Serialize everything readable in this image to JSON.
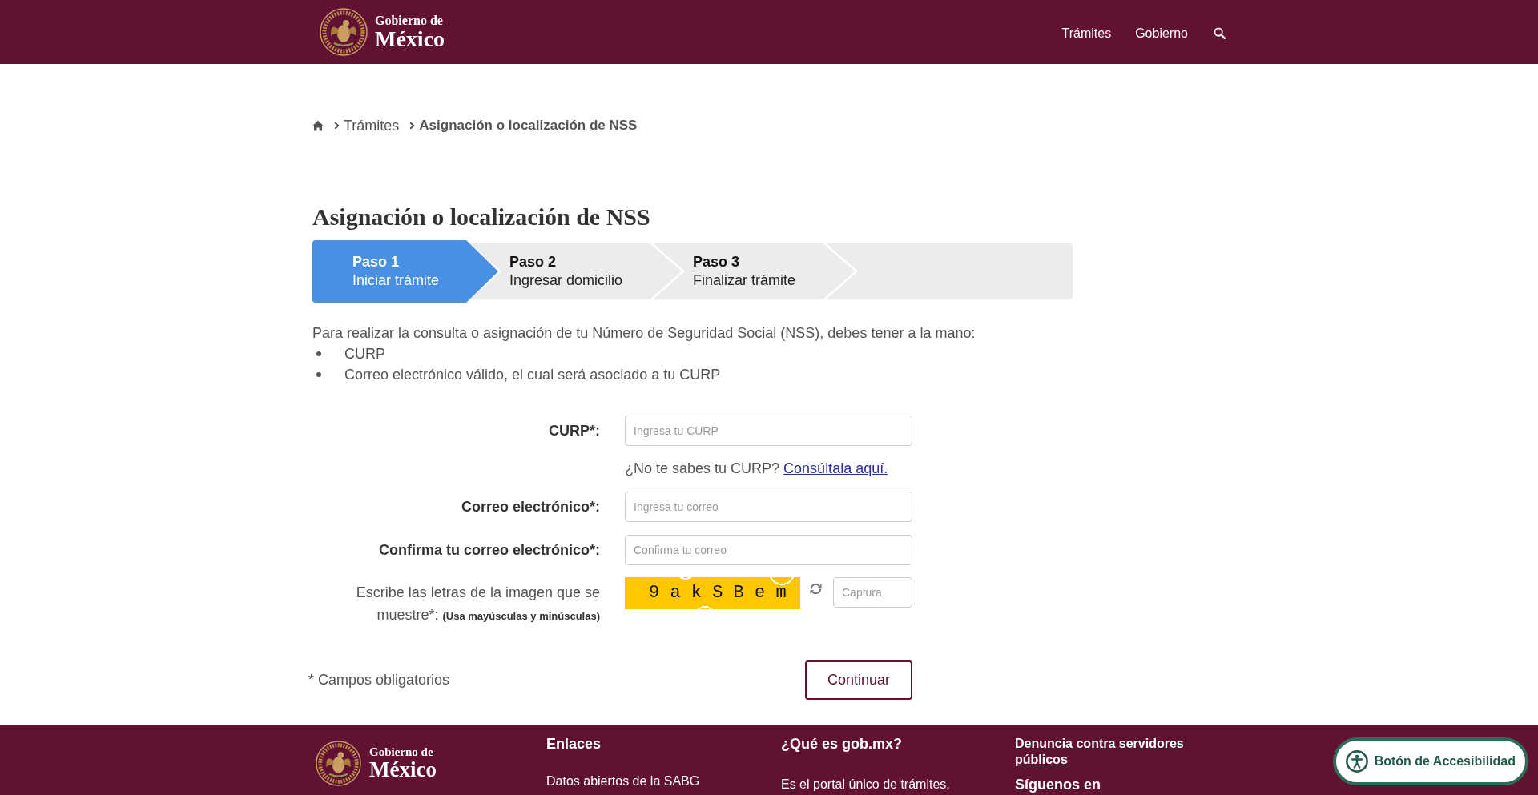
{
  "header": {
    "logo": {
      "line1": "Gobierno de",
      "line2": "México"
    },
    "nav": [
      "Trámites",
      "Gobierno"
    ]
  },
  "breadcrumb": [
    {
      "label": "Trámites",
      "current": false
    },
    {
      "label": "Asignación o localización de NSS",
      "current": true
    }
  ],
  "title": "Asignación o localización de NSS",
  "steps": [
    {
      "label": "Paso 1",
      "description": "Iniciar trámite",
      "selected": true
    },
    {
      "label": "Paso 2",
      "description": "Ingresar domicilio",
      "selected": false
    },
    {
      "label": "Paso 3",
      "description": "Finalizar trámite",
      "selected": false
    }
  ],
  "intro": {
    "text": "Para realizar la consulta o asignación de tu Número de Seguridad Social (NSS), debes tener a la mano:",
    "items": [
      "CURP",
      "Correo electrónico válido, el cual será asociado a tu CURP"
    ]
  },
  "form": {
    "fields": [
      {
        "kind": "text",
        "label": "CURP*:",
        "placeholder": "Ingresa tu CURP",
        "help": {
          "text": "¿No te sabes tu CURP?",
          "link": "Consúltala aquí."
        }
      },
      {
        "kind": "text",
        "label": "Correo electrónico*:",
        "placeholder": "Ingresa tu correo"
      },
      {
        "kind": "text",
        "label": "Confirma tu correo electrónico*:",
        "placeholder": "Confirma tu correo"
      },
      {
        "kind": "captcha",
        "label": "Escribe las letras de la imagen que se muestre*: **(Usa mayúsculas y minúsculas)**",
        "captcha_text": "9 a k S B e m",
        "placeholder": "Captura"
      }
    ],
    "required_note": "* Campos obligatorios",
    "submit": "Continuar"
  },
  "footer": {
    "logo": {
      "line1": "Gobierno de",
      "line2": "México"
    },
    "columns": [
      {
        "entries": [
          {
            "kind": "heading",
            "text": "Enlaces"
          },
          {
            "kind": "link",
            "text": "Datos abiertos de la SABG"
          }
        ]
      },
      {
        "entries": [
          {
            "kind": "heading",
            "text": "¿Qué es gob.mx?"
          },
          {
            "kind": "text",
            "text": "Es el portal único de trámites,"
          }
        ]
      },
      {
        "entries": [
          {
            "kind": "title_link",
            "text": "Denuncia contra servidores públicos"
          },
          {
            "kind": "heading",
            "text": "Síguenos en"
          }
        ]
      }
    ]
  },
  "accessibility_button": "Botón de Accesibilidad"
}
